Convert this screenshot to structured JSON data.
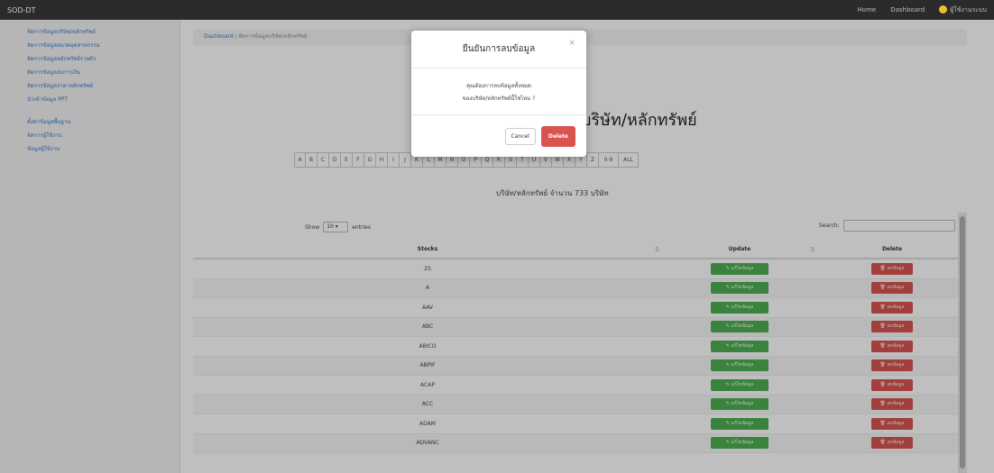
{
  "topbar": {
    "brand": "SOD-DT",
    "nav": [
      "Home",
      "Dashboard"
    ],
    "user": "ผู้ใช้งานระบบ"
  },
  "sidebar": {
    "items": [
      "จัดการข้อมูลบริษัท/หลักทรัพย์",
      "จัดการข้อมูลหมวดอุตสาหกรรม",
      "จัดการข้อมูลหลักทรัพย์รายตัว",
      "จัดการข้อมูลงบการเงิน",
      "จัดการข้อมูลราคาหลักทรัพย์",
      "นำเข้าข้อมูล PPT",
      "ตั้งค่าข้อมูลพื้นฐาน",
      "จัดการผู้ใช้งาน",
      "ข้อมูลผู้ใช้งาน"
    ]
  },
  "breadcrumb": {
    "home": "Dashboard",
    "current": "จัดการข้อมูลบริษัท/หลักทรัพย์"
  },
  "page": {
    "heading": "บริษัท/หลักทรัพย์",
    "summary": "บริษัท/หลักทรัพย์ จำนวน 733 บริษัท"
  },
  "alphabet": [
    "A",
    "B",
    "C",
    "D",
    "E",
    "F",
    "G",
    "H",
    "I",
    "J",
    "K",
    "L",
    "M",
    "N",
    "O",
    "P",
    "Q",
    "R",
    "S",
    "T",
    "U",
    "V",
    "W",
    "X",
    "Y",
    "Z",
    "0-9",
    "ALL"
  ],
  "table_controls": {
    "show_label": "Show",
    "entries_value": "10",
    "entries_suffix": "entries",
    "search_label": "Search:"
  },
  "table": {
    "headers": {
      "stock": "Stocks",
      "update": "Update",
      "delete": "Delete"
    },
    "update_button": "แก้ไขข้อมูล",
    "delete_button": "ลบข้อมูล",
    "rows": [
      "2S",
      "A",
      "AAV",
      "ABC",
      "ABICO",
      "ABPIF",
      "ACAP",
      "ACC",
      "ADAM",
      "ADVANC"
    ]
  },
  "modal": {
    "title": "ยืนยันการลบข้อมูล",
    "close": "×",
    "body_line1": "คุณต้องการลบข้อมูลทั้งหมด",
    "body_line2": "ของบริษัท/หลักทรัพย์นี้ใช่ไหม ?",
    "cancel": "Cancel",
    "confirm": "Delete"
  },
  "colors": {
    "update_green": "#4caf50",
    "delete_red": "#d9534f",
    "link_blue": "#3b7ac8"
  }
}
